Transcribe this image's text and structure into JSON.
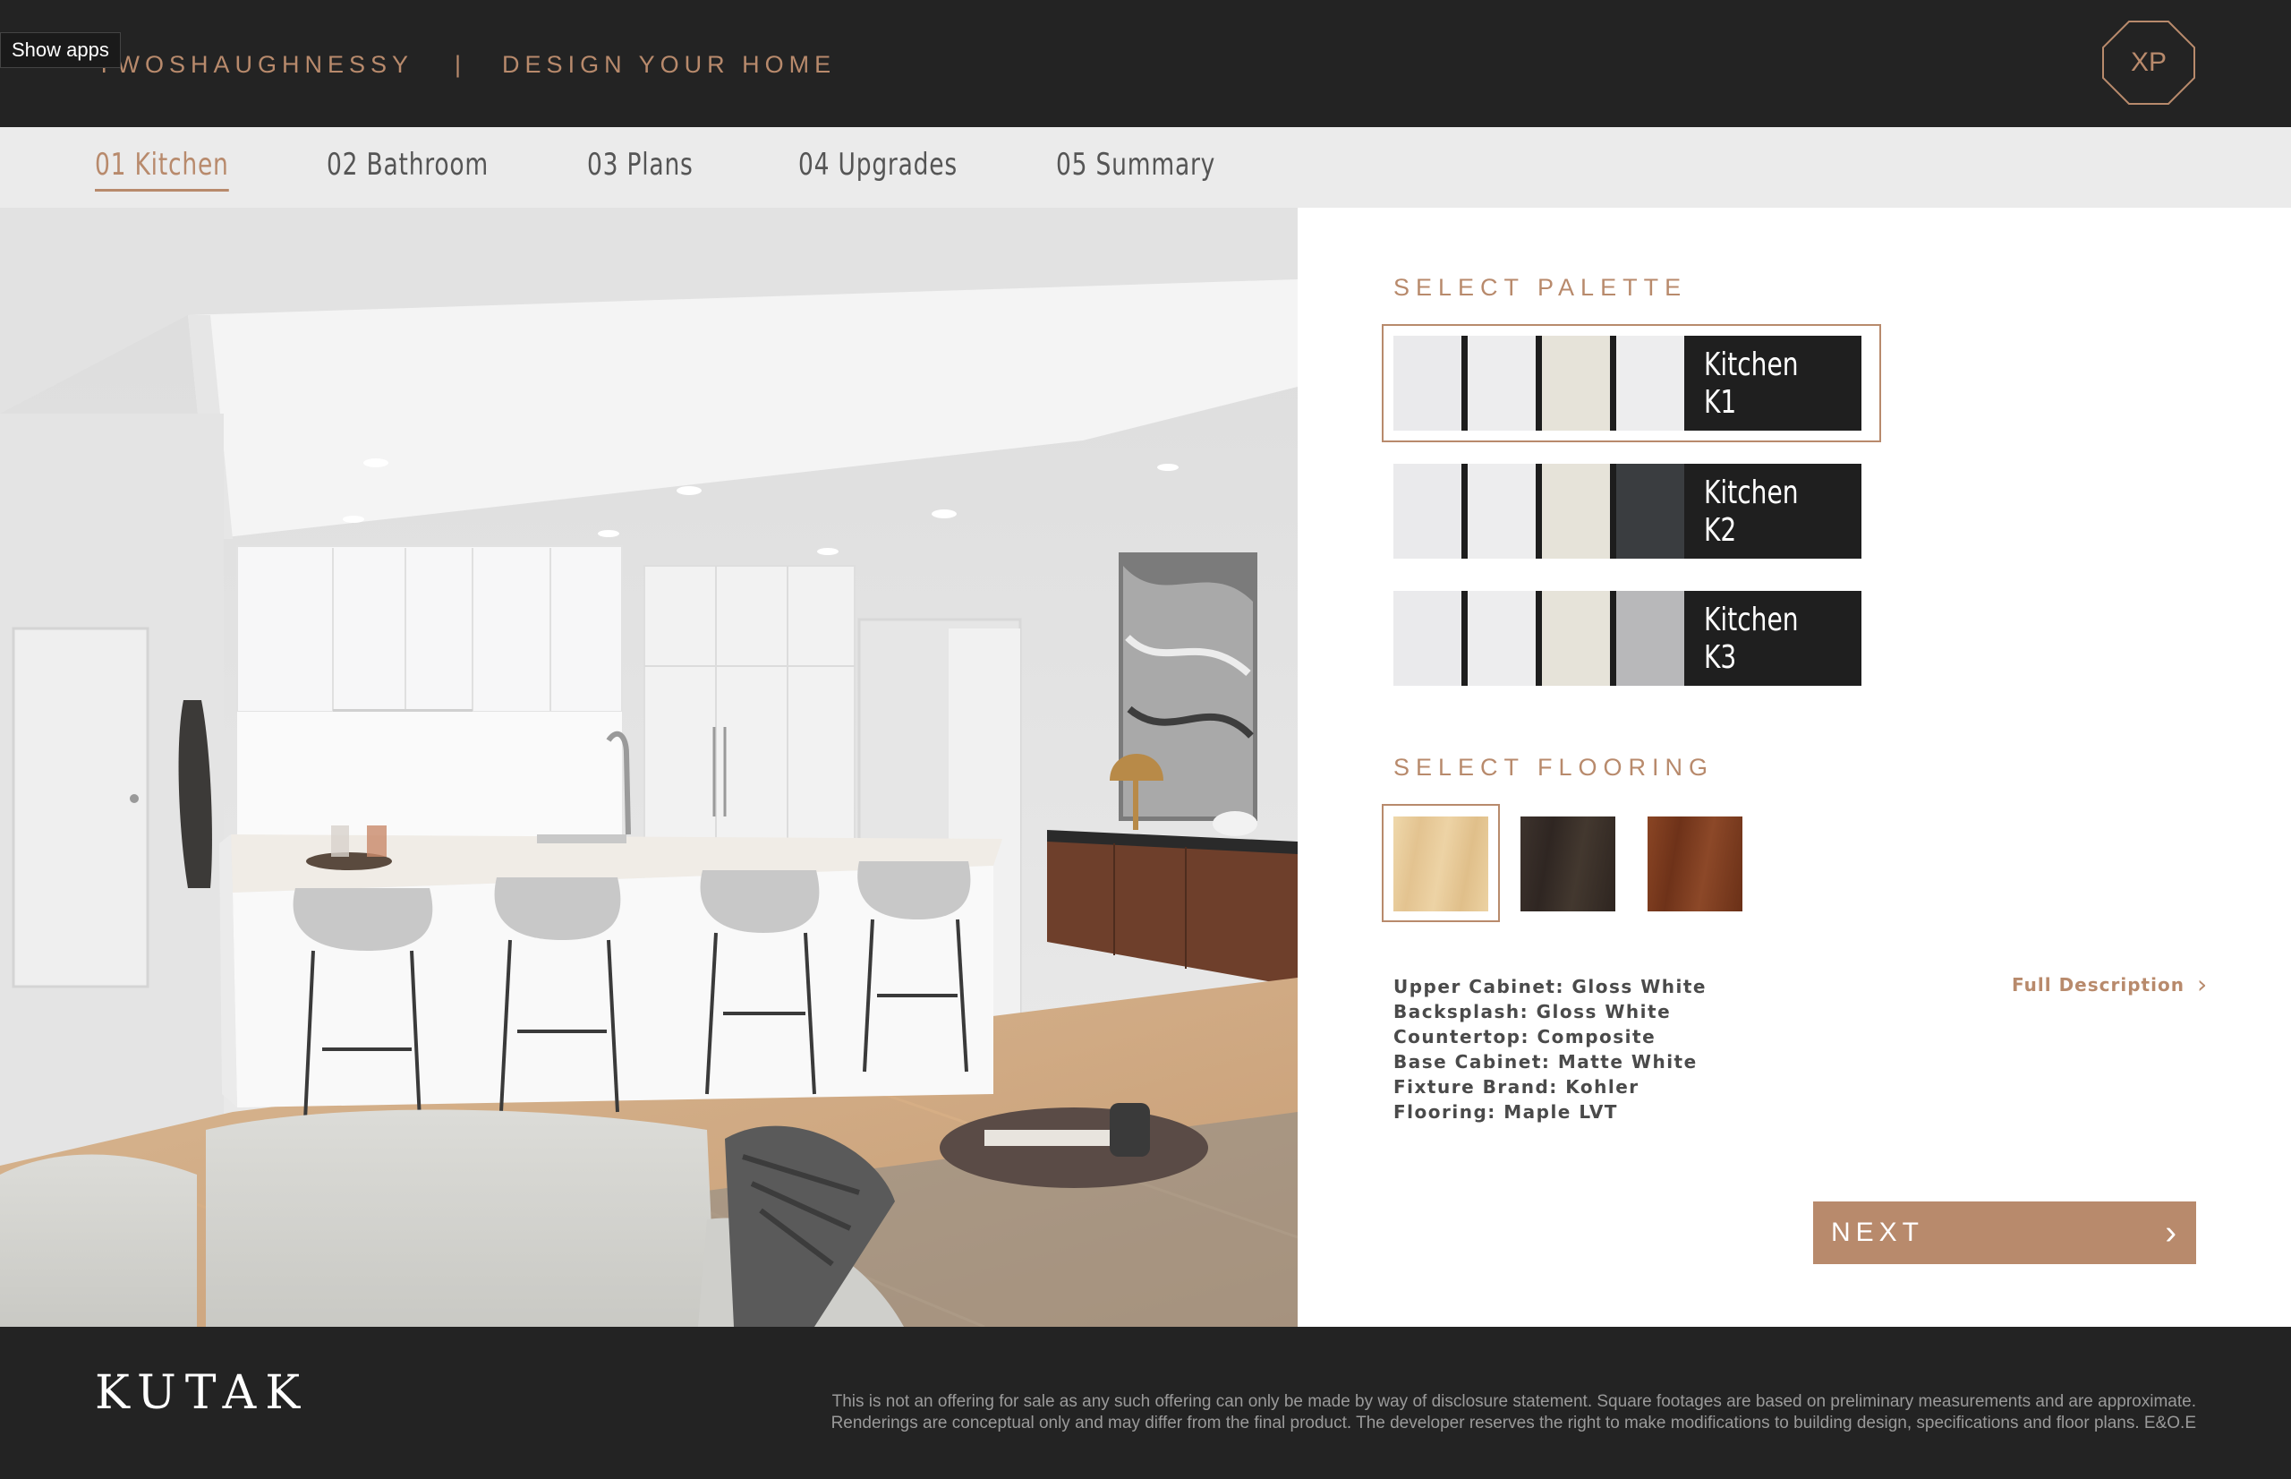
{
  "header": {
    "show_apps": "Show apps",
    "brand_name": "TWOSHAUGHNESSY",
    "separator": "|",
    "subtitle": "DESIGN YOUR HOME",
    "badge": "XP"
  },
  "nav": {
    "tabs": [
      {
        "label": "01  Kitchen",
        "active": true
      },
      {
        "label": "02  Bathroom",
        "active": false
      },
      {
        "label": "03  Plans",
        "active": false
      },
      {
        "label": "04  Upgrades",
        "active": false
      },
      {
        "label": "05  Summary",
        "active": false
      }
    ]
  },
  "panel": {
    "palette_title": "SELECT PALETTE",
    "palettes": [
      {
        "name_line1": "Kitchen",
        "name_line2": "K1",
        "selected": true,
        "swatch_colors": [
          "#eaeaec",
          "#ededee",
          "#e6e3d9",
          "#ededee"
        ]
      },
      {
        "name_line1": "Kitchen",
        "name_line2": "K2",
        "selected": false,
        "swatch_colors": [
          "#eaeaec",
          "#ededee",
          "#e6e3d9",
          "#3a3d40"
        ]
      },
      {
        "name_line1": "Kitchen",
        "name_line2": "K3",
        "selected": false,
        "swatch_colors": [
          "#eaeaec",
          "#ededee",
          "#e6e3d9",
          "#b8b8ba"
        ]
      }
    ],
    "flooring_title": "SELECT FLOORING",
    "flooring": [
      {
        "name": "maple",
        "color": "#e8cf9e",
        "selected": true
      },
      {
        "name": "dark-oak",
        "color": "#3a302a",
        "selected": false
      },
      {
        "name": "walnut",
        "color": "#7b3b1d",
        "selected": false
      }
    ],
    "specs": [
      "Upper Cabinet: Gloss White",
      "Backsplash: Gloss White",
      "Countertop: Composite",
      "Base Cabinet: Matte White",
      "Fixture Brand: Kohler",
      "Flooring: Maple LVT"
    ],
    "full_description": "Full Description",
    "next_label": "NEXT"
  },
  "footer": {
    "logo": "KUTAK",
    "disclaimer_line1": "This is not an offering for sale as any such offering can only be made by way of disclosure statement. Square footages are based on preliminary measurements and are approximate.",
    "disclaimer_line2": "Renderings are conceptual only and may differ from the final product. The developer reserves the right to make modifications to building design, specifications and floor plans. E&O.E"
  },
  "colors": {
    "accent": "#b88a6c",
    "dark": "#232323",
    "nav_bg": "#ebebeb"
  }
}
